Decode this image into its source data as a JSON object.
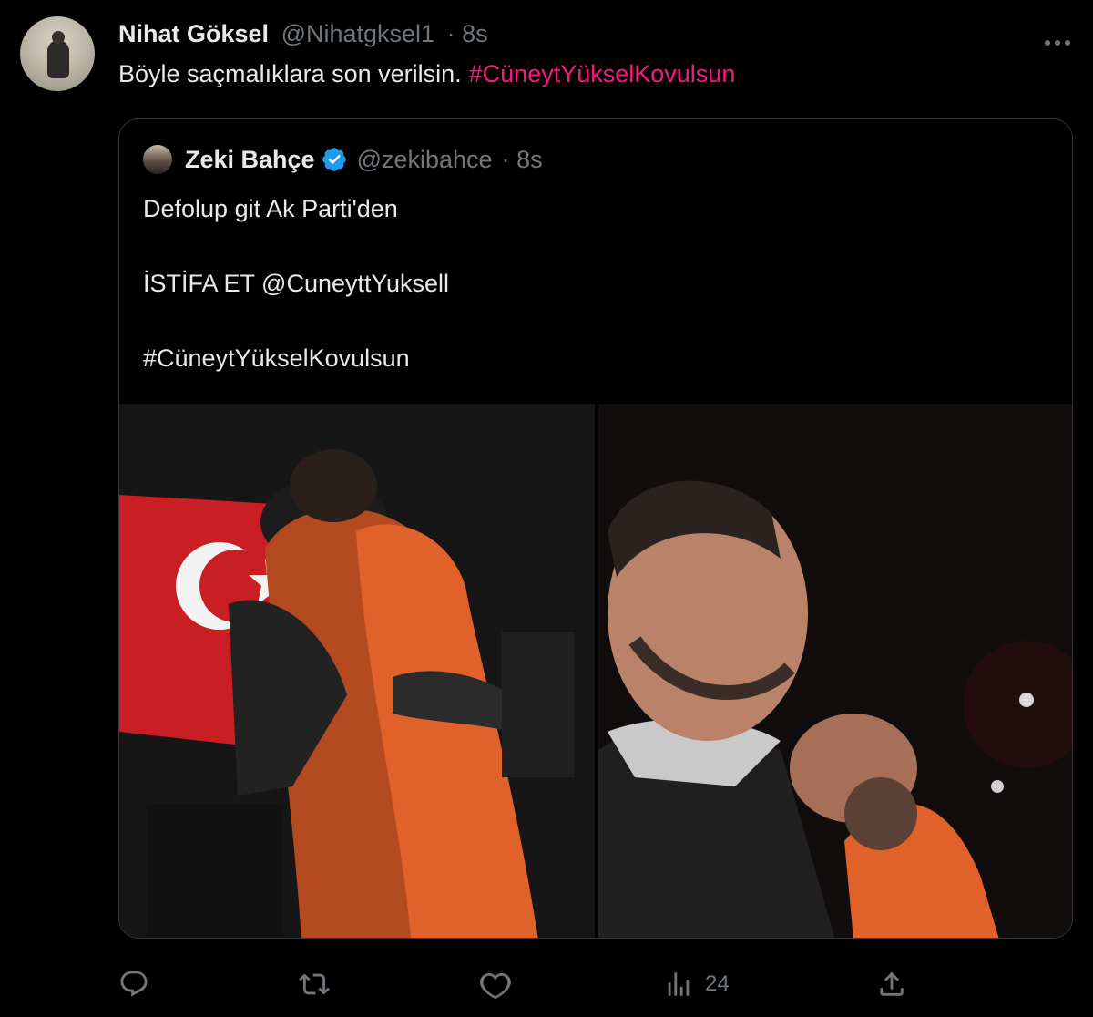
{
  "tweet": {
    "author_name": "Nihat Göksel",
    "author_handle": "@Nihatgksel1",
    "time": "· 8s",
    "text": "Böyle saçmalıklara son verilsin.",
    "hashtag": "#CüneytYükselKovulsun",
    "more_icon": "more-icon"
  },
  "quoted": {
    "author_name": "Zeki Bahçe",
    "verified": true,
    "author_handle": "@zekibahce",
    "time": "· 8s",
    "lines": [
      "Defolup git Ak Parti'den",
      "",
      "İSTİFA ET @CuneyttYuksell",
      "",
      "#CüneytYükselKovulsun"
    ]
  },
  "actions": {
    "reply_icon": "reply-icon",
    "retweet_icon": "retweet-icon",
    "like_icon": "like-icon",
    "views_icon": "views-icon",
    "views_count": "24",
    "share_icon": "share-icon"
  },
  "colors": {
    "background": "#000000",
    "text": "#e7e9ea",
    "muted": "#71767b",
    "hashtag": "#f91880",
    "verified": "#1d9bf0",
    "border": "#333639"
  }
}
